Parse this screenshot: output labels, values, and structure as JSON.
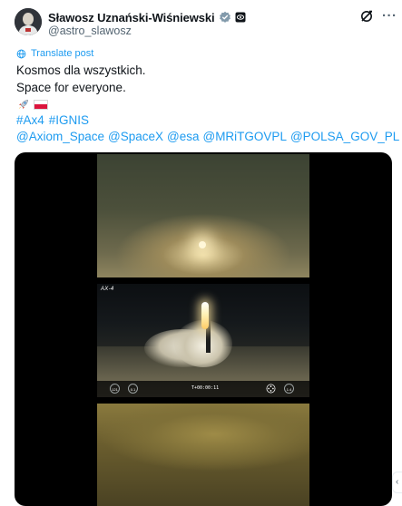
{
  "author": {
    "display_name": "Sławosz Uznański-Wiśniewski",
    "handle": "@astro_slawosz",
    "verified": true,
    "avatar_icon": "astronaut-avatar",
    "affiliation_icon": "esa-badge-icon"
  },
  "header": {
    "grok_icon": "grok-icon",
    "more_label": "···"
  },
  "translate_label": "Translate post",
  "post": {
    "line1": "Kosmos dla wszystkich.",
    "line2": "Space for everyone.",
    "emojis": [
      "rocket-emoji",
      "poland-flag-emoji"
    ],
    "hashtags": [
      "#Ax4",
      "#IGNIS"
    ],
    "mentions": [
      "@Axiom_Space",
      "@SpaceX",
      "@esa",
      "@MRiTGOVPL",
      "@POLSA_GOV_PL"
    ]
  },
  "media": {
    "panel2_label": "AX-4",
    "hud_left": [
      "121",
      "0.1"
    ],
    "hud_time": "T+00:00:11",
    "hud_right": "1.4"
  },
  "colors": {
    "link": "#1d9bf0",
    "text": "#0f1419",
    "secondary": "#536471",
    "verified_badge": "#829aab"
  }
}
